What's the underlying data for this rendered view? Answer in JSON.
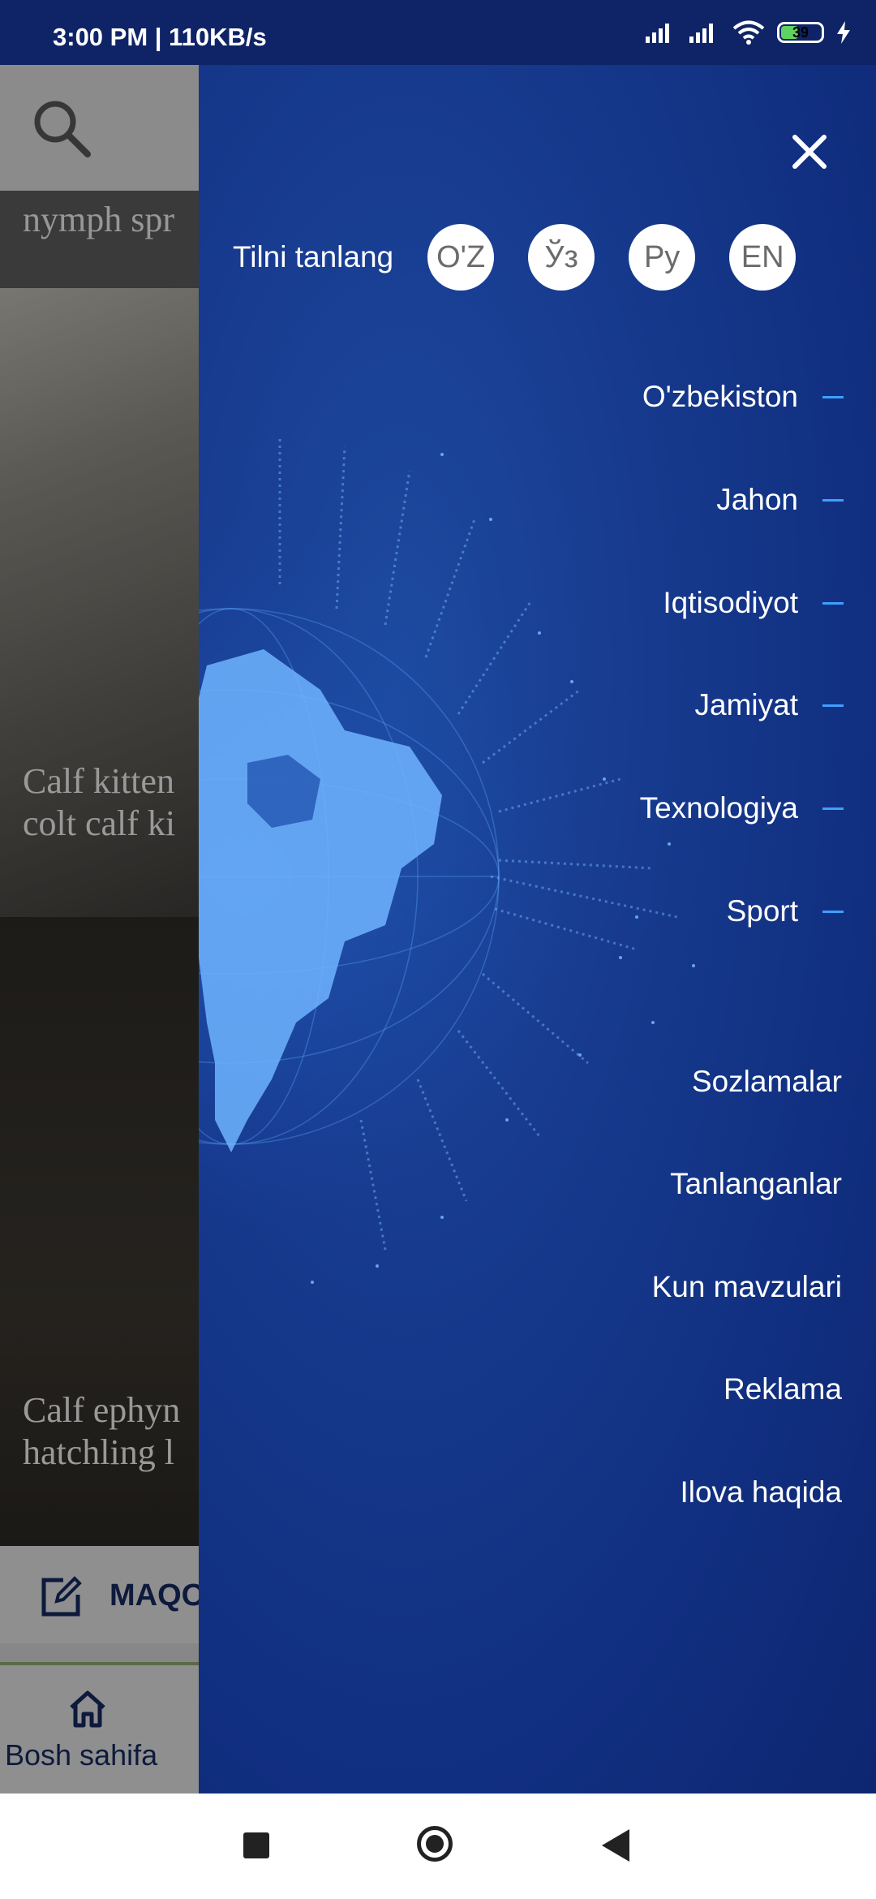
{
  "status_bar": {
    "time": "3:00 PM | 110KB/s",
    "battery": "39"
  },
  "background": {
    "card1_title": "nymph spr",
    "card2_title_line1": "Calf kitten",
    "card2_title_line2": "colt calf ki",
    "card3_title_line1": "Calf ephyn",
    "card3_title_line2": "hatchling l",
    "action_label": "MAQO",
    "nav_home_label": "Bosh sahifa"
  },
  "drawer": {
    "language_label": "Tilni tanlang",
    "languages": [
      "O'Z",
      "Ўз",
      "Ру",
      "EN"
    ],
    "sections": [
      "O'zbekiston",
      "Jahon",
      "Iqtisodiyot",
      "Jamiyat",
      "Texnologiya",
      "Sport"
    ],
    "links": [
      "Sozlamalar",
      "Tanlanganlar",
      "Kun mavzulari",
      "Reklama",
      "Ilova haqida"
    ],
    "accent_color": "#3ea0ff",
    "background_color": "#173b8f"
  }
}
